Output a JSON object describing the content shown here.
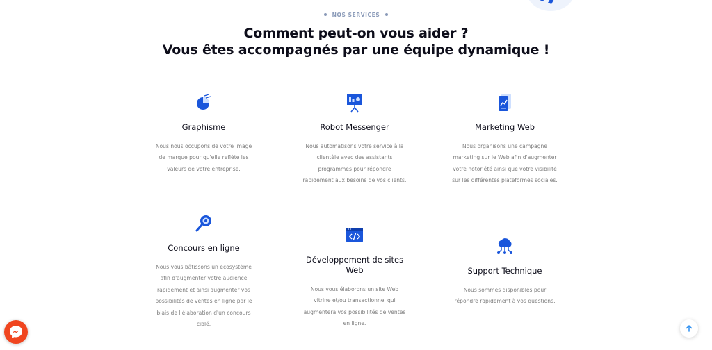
{
  "section": {
    "eyebrow": "NOS SERVICES",
    "title_line1": "Comment peut-on vous aider ?",
    "title_line2": "Vous êtes accompagnés par une équipe dynamique !"
  },
  "services": [
    {
      "icon": "pie-chart-icon",
      "title": "Graphisme",
      "description": "Nous nous occupons de votre image de marque pour qu'elle reflète les valeurs de votre entreprise."
    },
    {
      "icon": "presentation-board-icon",
      "title": "Robot Messenger",
      "description": "Nous automatisons votre service à la clientèle avec des assistants programmés pour répondre rapidement aux besoins de vos clients."
    },
    {
      "icon": "mobile-analytics-icon",
      "title": "Marketing Web",
      "description": "Nous organisons une campagne marketing sur le Web afin d'augmenter votre notoriété ainsi que votre visibilité sur les différentes plateformes sociales."
    },
    {
      "icon": "magnifier-icon",
      "title": "Concours en ligne",
      "description": "Nous vous bâtissons un écosystème afin d'augmenter votre audience rapidement et ainsi augmenter vos possibilités de ventes en ligne par le biais de l'élaboration d'un concours ciblé."
    },
    {
      "icon": "code-window-icon",
      "title": "Développement de sites Web",
      "description": "Nous vous élaborons un site Web vitrine et/ou transactionnel qui augmentera vos possibilités de ventes en ligne."
    },
    {
      "icon": "cloud-network-icon",
      "title": "Support Technique",
      "description": "Nous sommes disponibles pour répondre rapidement à vos questions."
    }
  ],
  "colors": {
    "accent": "#1a56db",
    "accent_light": "#cfe0ff",
    "messenger": "#f0451f",
    "scroll_arrow": "#2b8ef0"
  }
}
